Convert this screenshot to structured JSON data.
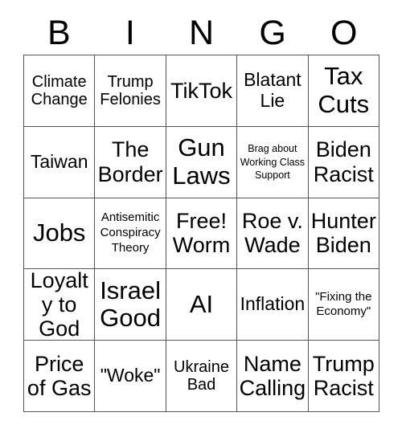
{
  "card": {
    "type": "bingo-card",
    "header_letters": [
      "B",
      "I",
      "N",
      "G",
      "O"
    ],
    "columns": 5,
    "rows": 5,
    "colors": {
      "background": "#ffffff",
      "text": "#000000",
      "grid_line": "#555555"
    },
    "cells": [
      [
        {
          "text": "Climate Change",
          "size": "md"
        },
        {
          "text": "Trump Felonies",
          "size": "md"
        },
        {
          "text": "TikTok",
          "size": "xl"
        },
        {
          "text": "Blatant Lie",
          "size": "lg"
        },
        {
          "text": "Tax Cuts",
          "size": "xxl"
        }
      ],
      [
        {
          "text": "Taiwan",
          "size": "lg"
        },
        {
          "text": "The Border",
          "size": "xl"
        },
        {
          "text": "Gun Laws",
          "size": "xxl"
        },
        {
          "text": "Brag about Working Class Support",
          "size": "xs"
        },
        {
          "text": "Biden Racist",
          "size": "xl"
        }
      ],
      [
        {
          "text": "Jobs",
          "size": "xxl"
        },
        {
          "text": "Antisemitic Conspiracy Theory",
          "size": "sm"
        },
        {
          "text": "Free! Worm",
          "size": "xl"
        },
        {
          "text": "Roe v. Wade",
          "size": "xl"
        },
        {
          "text": "Hunter Biden",
          "size": "xl"
        }
      ],
      [
        {
          "text": "Loyalty to God",
          "size": "xl"
        },
        {
          "text": "Israel Good",
          "size": "xxl"
        },
        {
          "text": "AI",
          "size": "xxl"
        },
        {
          "text": "Inflation",
          "size": "lg"
        },
        {
          "text": "\"Fixing the Economy\"",
          "size": "sm"
        }
      ],
      [
        {
          "text": "Price of Gas",
          "size": "xl"
        },
        {
          "text": "\"Woke\"",
          "size": "lg"
        },
        {
          "text": "Ukraine Bad",
          "size": "md"
        },
        {
          "text": "Name Calling",
          "size": "xl"
        },
        {
          "text": "Trump Racist",
          "size": "xl"
        }
      ]
    ]
  }
}
